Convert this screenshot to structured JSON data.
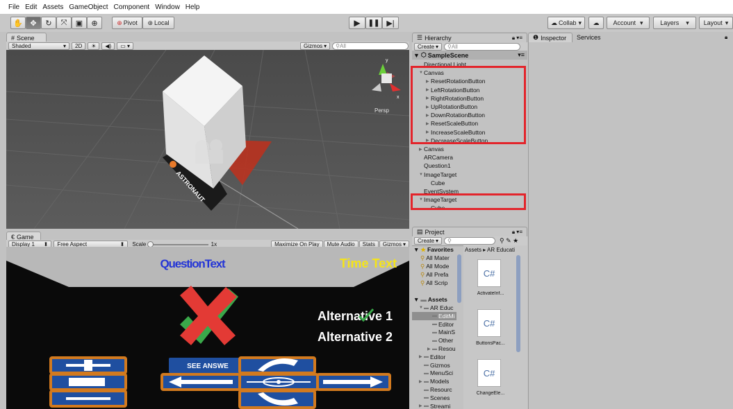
{
  "menu": [
    "File",
    "Edit",
    "Assets",
    "GameObject",
    "Component",
    "Window",
    "Help"
  ],
  "toolbar": {
    "pivot": "Pivot",
    "local": "Local",
    "collab": "Collab",
    "account": "Account",
    "layers": "Layers",
    "layout": "Layout"
  },
  "scene": {
    "tab": "Scene",
    "shading": "Shaded",
    "mode2d": "2D",
    "gizmos": "Gizmos",
    "search_placeholder": "All",
    "persp": "Persp",
    "card_label": "ASTRONAUT"
  },
  "game": {
    "tab": "Game",
    "display": "Display 1",
    "aspect": "Free Aspect",
    "scale": "Scale",
    "scale_value": "1x",
    "maximize": "Maximize On Play",
    "mute": "Mute Audio",
    "stats": "Stats",
    "gizmos": "Gizmos",
    "question_text": "QuestionText",
    "time_text": "Time Text",
    "alt1": "Alternative 1",
    "alt2": "Alternative 2",
    "see_answer": "SEE ANSWE"
  },
  "hierarchy": {
    "tab": "Hierarchy",
    "create": "Create",
    "search_placeholder": "All",
    "scene_name": "SampleScene",
    "items": [
      {
        "label": "Directional Light",
        "indent": 1,
        "arrow": ""
      },
      {
        "label": "Canvas",
        "indent": 1,
        "arrow": "▼"
      },
      {
        "label": "ResetRotationButton",
        "indent": 2,
        "arrow": "▶"
      },
      {
        "label": "LeftRotationButton",
        "indent": 2,
        "arrow": "▶"
      },
      {
        "label": "RightRotationButton",
        "indent": 2,
        "arrow": "▶"
      },
      {
        "label": "UpRotationButton",
        "indent": 2,
        "arrow": "▶"
      },
      {
        "label": "DownRotationButton",
        "indent": 2,
        "arrow": "▶"
      },
      {
        "label": "ResetScaleButton",
        "indent": 2,
        "arrow": "▶"
      },
      {
        "label": "IncreaseScaleButton",
        "indent": 2,
        "arrow": "▶"
      },
      {
        "label": "DecreaseScaleButton",
        "indent": 2,
        "arrow": "▶"
      },
      {
        "label": "Canvas",
        "indent": 1,
        "arrow": "▶"
      },
      {
        "label": "ARCamera",
        "indent": 1,
        "arrow": ""
      },
      {
        "label": "Question1",
        "indent": 1,
        "arrow": ""
      },
      {
        "label": "ImageTarget",
        "indent": 1,
        "arrow": "▼"
      },
      {
        "label": "Cube",
        "indent": 2,
        "arrow": ""
      },
      {
        "label": "EventSystem",
        "indent": 1,
        "arrow": ""
      },
      {
        "label": "ImageTarget",
        "indent": 1,
        "arrow": "▼"
      },
      {
        "label": "Cube",
        "indent": 2,
        "arrow": ""
      }
    ]
  },
  "project": {
    "tab": "Project",
    "create": "Create",
    "favorites": "Favorites",
    "fav_items": [
      "All Mater",
      "All Mode",
      "All Prefa",
      "All Scrip"
    ],
    "assets": "Assets",
    "asset_tree": [
      {
        "label": "AR Educ",
        "indent": 1,
        "arrow": "▼"
      },
      {
        "label": "EditMi",
        "indent": 2,
        "arrow": ""
      },
      {
        "label": "Editor",
        "indent": 2,
        "arrow": ""
      },
      {
        "label": "MainS",
        "indent": 2,
        "arrow": ""
      },
      {
        "label": "Other",
        "indent": 2,
        "arrow": ""
      },
      {
        "label": "Resou",
        "indent": 2,
        "arrow": "▶"
      },
      {
        "label": "Editor",
        "indent": 1,
        "arrow": "▶"
      },
      {
        "label": "Gizmos",
        "indent": 1,
        "arrow": ""
      },
      {
        "label": "MenuSci",
        "indent": 1,
        "arrow": ""
      },
      {
        "label": "Models",
        "indent": 1,
        "arrow": "▶"
      },
      {
        "label": "Resourc",
        "indent": 1,
        "arrow": ""
      },
      {
        "label": "Scenes",
        "indent": 1,
        "arrow": ""
      },
      {
        "label": "Streami",
        "indent": 1,
        "arrow": "▶"
      }
    ],
    "breadcrumb": "Assets ▸ AR Educati",
    "files": [
      {
        "icon": "C#",
        "name": "ActivateInf..."
      },
      {
        "icon": "C#",
        "name": "ButtonsPac..."
      },
      {
        "icon": "C#",
        "name": "ChangeEle..."
      }
    ]
  },
  "inspector": {
    "tab": "Inspector",
    "services": "Services"
  },
  "colors": {
    "highlight_red": "#e3242b",
    "question_blue": "#2435d6",
    "time_yellow": "#f5e419",
    "button_orange": "#d27a1f",
    "button_blue": "#1f4fa0"
  }
}
